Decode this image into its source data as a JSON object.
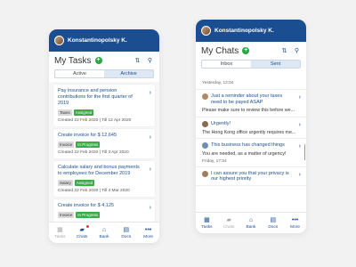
{
  "tasks_screen": {
    "user_name": "Konstantinopolsky K.",
    "title": "My Tasks",
    "add_symbol": "+",
    "segments": [
      "Active",
      "Archive"
    ],
    "active_segment": "Archive",
    "tasks": [
      {
        "title": "Pay insurance and pension contributions for the first quarter of 2019",
        "tags": [
          {
            "label": "Taxes",
            "style": "gray"
          },
          {
            "label": "Assigned",
            "style": "green"
          }
        ],
        "meta": "Created 22 Feb 2020 | Till 12 Apr 2020"
      },
      {
        "title": "Create invoice for $ 12,645",
        "tags": [
          {
            "label": "Invoice",
            "style": "gray"
          },
          {
            "label": "In Progress",
            "style": "green"
          }
        ],
        "meta": "Created 22 Feb 2020 | Till 3 Apr 2020"
      },
      {
        "title": "Calculate salary and bonus payments to employees for December 2019",
        "tags": [
          {
            "label": "Salary",
            "style": "gray"
          },
          {
            "label": "Assigned",
            "style": "green"
          }
        ],
        "meta": "Created 22 Feb 2020 | Till 4 Mar 2020"
      },
      {
        "title": "Create invoice for $ 4,125",
        "tags": [
          {
            "label": "Invoice",
            "style": "gray"
          },
          {
            "label": "In Progress",
            "style": "green"
          }
        ],
        "meta": ""
      }
    ],
    "tabbar": [
      {
        "label": "Tasks",
        "icon": "tasks-icon",
        "dim": true
      },
      {
        "label": "Chats",
        "icon": "chats-icon",
        "dim": false,
        "badge": true
      },
      {
        "label": "Bank",
        "icon": "bank-icon",
        "dim": false
      },
      {
        "label": "Docs",
        "icon": "docs-icon",
        "dim": false
      },
      {
        "label": "More",
        "icon": "more-icon",
        "dim": false
      }
    ]
  },
  "chats_screen": {
    "user_name": "Konstantinopolsky K.",
    "title": "My Chats",
    "add_symbol": "+",
    "segments": [
      "Inbox",
      "Sent"
    ],
    "active_segment": "Sent",
    "first_time": "Yesterday, 12:04",
    "messages": [
      {
        "subject": "Just a reminder about your taxes need to be payed ASAP",
        "body": "Please make sure to review this before we...",
        "time": "",
        "avatar_color": "#b08a66"
      },
      {
        "subject": "Urgently!",
        "body": "The Hong Kong office urgently requires me...",
        "time": "",
        "avatar_color": "#8a6b52"
      },
      {
        "subject": "This business has changed things",
        "body": "You are needed, as a matter of urgency!",
        "time": "Friday, 17:34",
        "avatar_color": "#6f8fb0"
      },
      {
        "subject": "I can assure you that your privacy is our highest priority",
        "body": "",
        "time": "",
        "avatar_color": "#a07d5e"
      }
    ],
    "tabbar": [
      {
        "label": "Tasks",
        "icon": "tasks-icon",
        "dim": false
      },
      {
        "label": "Chats",
        "icon": "chats-icon",
        "dim": true
      },
      {
        "label": "Bank",
        "icon": "bank-icon",
        "dim": false
      },
      {
        "label": "Docs",
        "icon": "docs-icon",
        "dim": false
      },
      {
        "label": "More",
        "icon": "more-icon",
        "dim": false
      }
    ]
  }
}
